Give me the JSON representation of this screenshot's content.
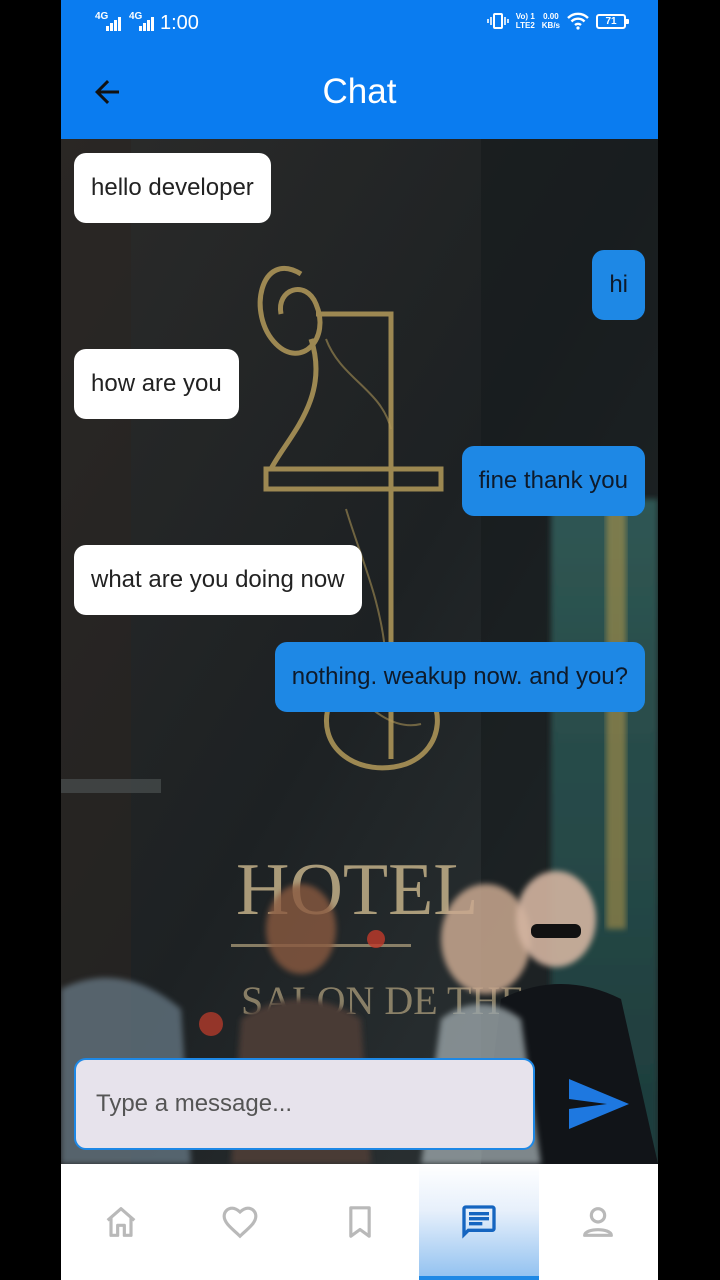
{
  "status_bar": {
    "sim1": "4G",
    "sim2": "4G",
    "time": "1:00",
    "volte_top": "Vo) 1",
    "volte_bottom": "LTE2",
    "speed_value": "0.00",
    "speed_unit": "KB/s",
    "battery": "71"
  },
  "app_bar": {
    "title": "Chat",
    "back_icon": "arrow-back-icon"
  },
  "messages": [
    {
      "side": "in",
      "text": "hello developer"
    },
    {
      "side": "out",
      "text": "hi"
    },
    {
      "side": "in",
      "text": "how are you"
    },
    {
      "side": "out",
      "text": "fine thank you"
    },
    {
      "side": "in",
      "text": "what are you doing now"
    },
    {
      "side": "out",
      "text": "nothing. weakup now. and you?"
    }
  ],
  "composer": {
    "placeholder": "Type a message...",
    "value": "",
    "send_icon": "send-icon"
  },
  "bottom_nav": {
    "items": [
      {
        "name": "home",
        "icon": "home-icon",
        "active": false
      },
      {
        "name": "favorites",
        "icon": "heart-icon",
        "active": false
      },
      {
        "name": "bookmarks",
        "icon": "bookmark-icon",
        "active": false
      },
      {
        "name": "chat",
        "icon": "chat-icon",
        "active": true
      },
      {
        "name": "profile",
        "icon": "person-icon",
        "active": false
      }
    ]
  },
  "colors": {
    "primary": "#0a7cf0",
    "outgoing_bubble": "#1e88e5",
    "incoming_bubble": "#ffffff",
    "nav_inactive": "#b9b9b9",
    "nav_active": "#1565c0"
  }
}
